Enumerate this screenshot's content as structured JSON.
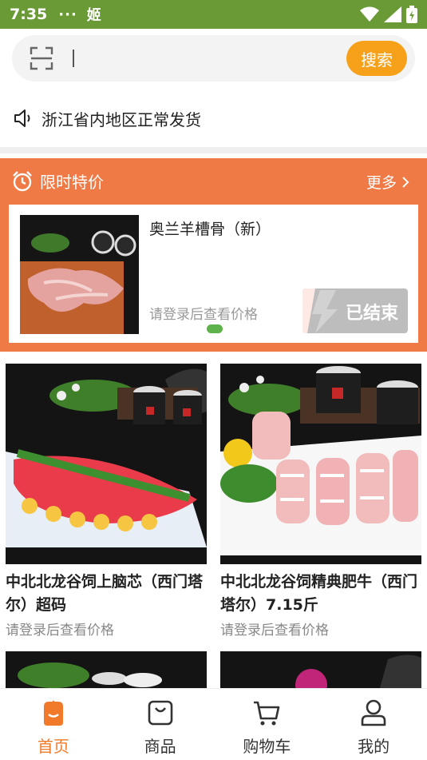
{
  "status_bar": {
    "time": "7:35",
    "dots": "···",
    "app_glyph": "姬"
  },
  "search": {
    "placeholder": "",
    "button_label": "搜索"
  },
  "notice": {
    "text": "浙江省内地区正常发货"
  },
  "flash_sale": {
    "title": "限时特价",
    "more_label": "更多",
    "item": {
      "name": "奥兰羊槽骨（新）",
      "price_hint": "请登录后查看价格",
      "status": "已结束"
    }
  },
  "products": [
    {
      "title": "中北北龙谷饲上脑芯（西门塔尔）超码",
      "price_hint": "请登录后查看价格"
    },
    {
      "title": "中北北龙谷饲精典肥牛（西门塔尔）7.15斤",
      "price_hint": "请登录后查看价格"
    }
  ],
  "bottom_nav": [
    {
      "label": "首页",
      "icon": "home-icon",
      "active": true
    },
    {
      "label": "商品",
      "icon": "bag-icon",
      "active": false
    },
    {
      "label": "购物车",
      "icon": "cart-icon",
      "active": false
    },
    {
      "label": "我的",
      "icon": "user-icon",
      "active": false
    }
  ],
  "colors": {
    "status_bar": "#6a9a36",
    "accent": "#f07a45",
    "search_button": "#f7a11a",
    "active_nav": "#f07a2a"
  }
}
